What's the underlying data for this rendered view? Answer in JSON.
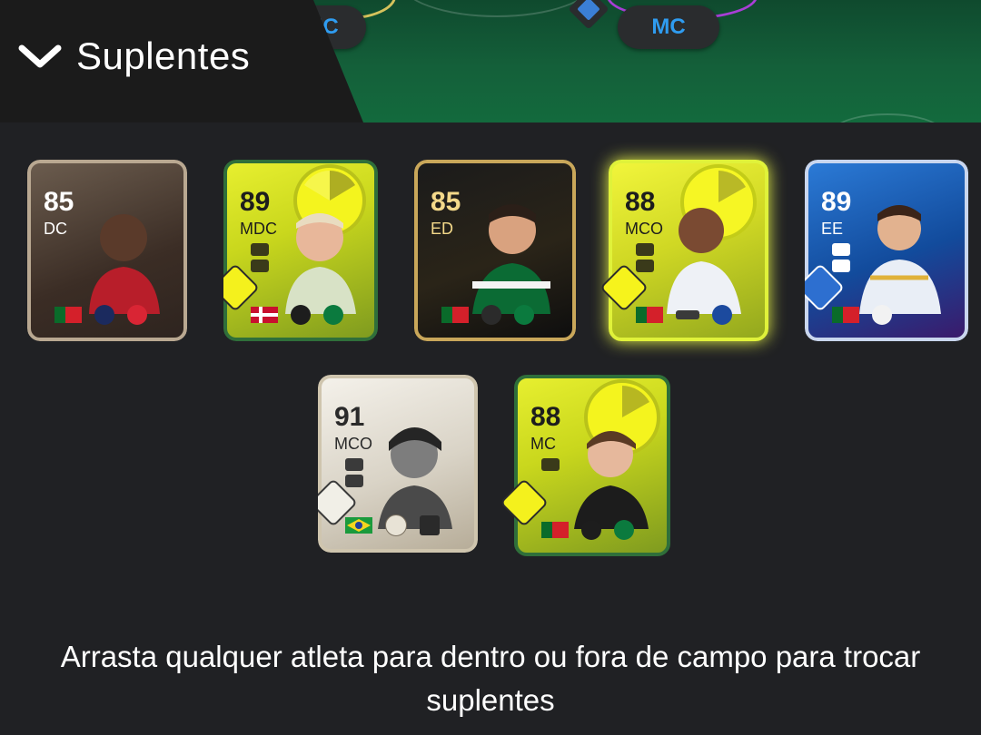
{
  "pitch": {
    "chips": [
      {
        "label": "MC"
      },
      {
        "label": "MC"
      }
    ]
  },
  "header": {
    "title": "Suplentes",
    "chevron_icon": "chevron-down-icon"
  },
  "cards": [
    {
      "rating": "85",
      "position": "DC",
      "theme": "brown"
    },
    {
      "rating": "89",
      "position": "MDC",
      "theme": "yellow"
    },
    {
      "rating": "85",
      "position": "ED",
      "theme": "black"
    },
    {
      "rating": "88",
      "position": "MCO",
      "theme": "yellow-glow"
    },
    {
      "rating": "89",
      "position": "EE",
      "theme": "blue"
    },
    {
      "rating": "91",
      "position": "MCO",
      "theme": "icon"
    },
    {
      "rating": "88",
      "position": "MC",
      "theme": "yellow"
    }
  ],
  "footer": {
    "instruction": "Arrasta qualquer atleta para dentro ou fora de campo para trocar suplentes"
  },
  "colors": {
    "background": "#202124",
    "chip_text": "#2f9cf0",
    "pitch_green": "#136a3d"
  }
}
